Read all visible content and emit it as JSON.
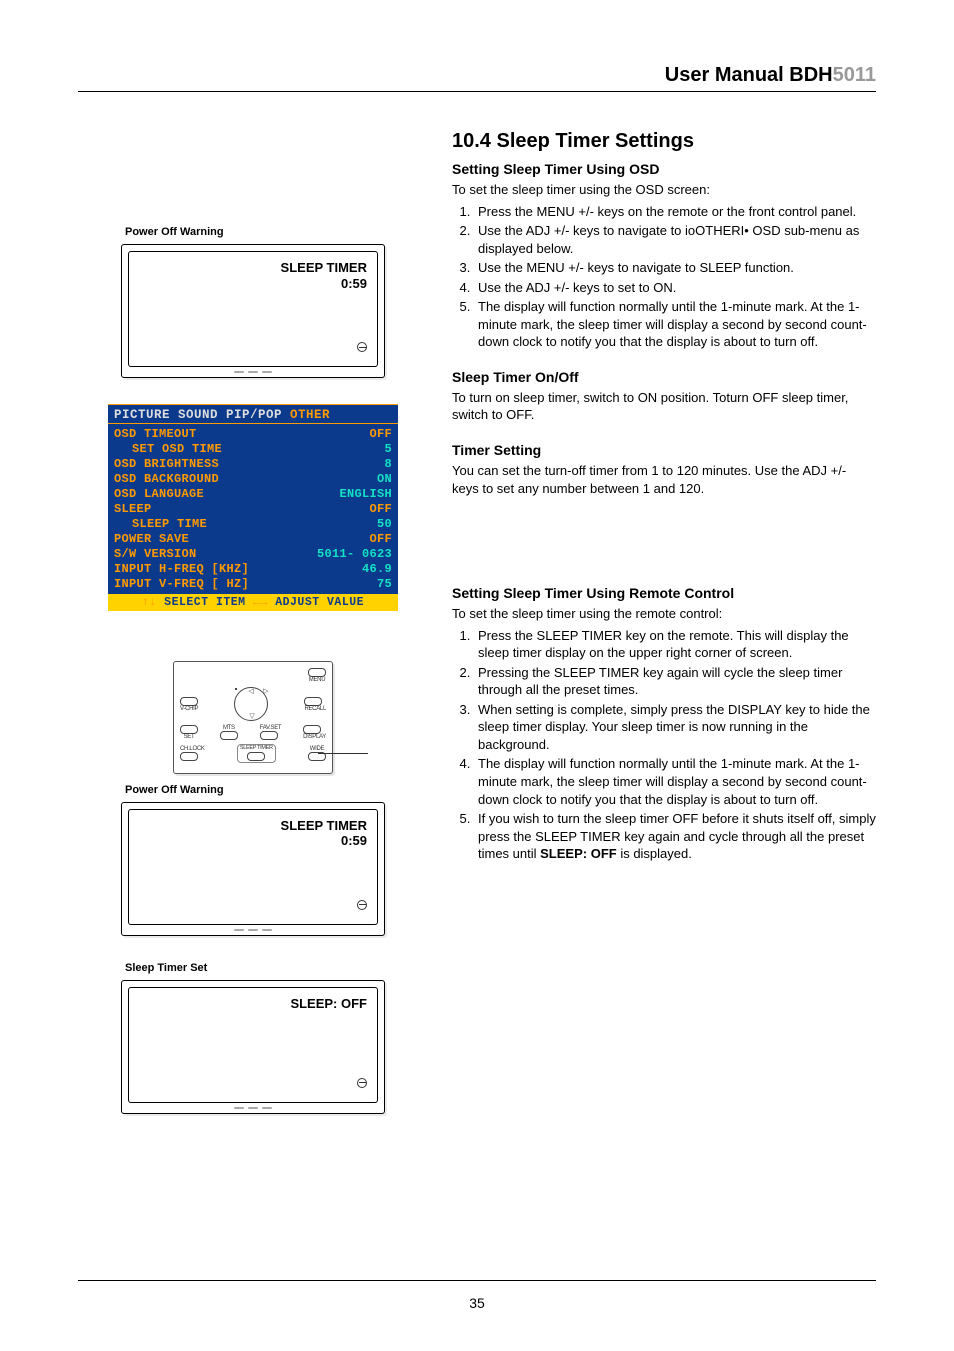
{
  "header": {
    "title": "User Manual BDH",
    "model": "5011"
  },
  "section": {
    "number_title": "10.4 Sleep Timer Settings",
    "osd_h": "Setting Sleep Timer Using OSD",
    "osd_intro": "To set the sleep timer using the OSD screen:",
    "osd_steps": [
      "Press the MENU +/- keys on the remote or the front control panel.",
      "Use the ADJ +/- keys to navigate to ioOTHERI• OSD sub-menu as displayed below.",
      "Use the MENU +/- keys to navigate to SLEEP function.",
      "Use the ADJ +/- keys to set to ON.",
      "The display will function normally until the 1-minute mark.  At the 1- minute mark, the sleep timer will display a second by second count- down clock to notify you that the display is about to turn off."
    ],
    "onoff_h": "Sleep Timer On/Off",
    "onoff_p": "To turn on sleep timer, switch to ON position. Toturn OFF sleep timer, switch to OFF.",
    "tset_h": "Timer Setting",
    "tset_p": "You can set the turn-off timer from 1 to 120 minutes. Use the ADJ +/- keys to set any number between 1 and 120.",
    "remote_h": "Setting Sleep Timer Using Remote Control",
    "remote_intro": "To set the sleep timer using the remote control:",
    "remote_steps": [
      "Press the SLEEP TIMER key on the remote.  This will display the sleep timer display on the upper right corner of screen.",
      "Pressing the SLEEP TIMER key again will cycle the sleep timer through all the preset times.",
      " When setting is complete, simply press the DISPLAY key to hide the sleep timer display.  Your sleep timer is now running in the background.",
      "The display will function normally until the 1-minute mark.  At the 1- minute mark, the sleep timer will display a second by second count-down clock to notify you that the display is about to turn off.",
      "If you wish to turn the sleep timer OFF before it shuts itself off, simply press the SLEEP TIMER key again and cycle through all the preset times until SLEEP: OFF is displayed."
    ]
  },
  "tv": {
    "caption_poweroff": "Power Off Warning",
    "caption_sleepset": "Sleep Timer Set",
    "sleep_timer_label": "SLEEP TIMER",
    "sleep_timer_value": "0:59",
    "sleep_off_label": "SLEEP: OFF"
  },
  "osd_menu": {
    "tabs": [
      "PICTURE",
      "SOUND",
      "PIP/POP",
      "OTHER"
    ],
    "active_tab_index": 3,
    "rows": [
      {
        "label": "OSD TIMEOUT",
        "value": "OFF",
        "vclass": "val-off",
        "indent": false
      },
      {
        "label": "SET OSD TIME",
        "value": "5",
        "vclass": "val-num",
        "indent": true
      },
      {
        "label": "OSD BRIGHTNESS",
        "value": "8",
        "vclass": "val-num",
        "indent": false
      },
      {
        "label": "OSD BACKGROUND",
        "value": "ON",
        "vclass": "val-on",
        "indent": false
      },
      {
        "label": "OSD LANGUAGE",
        "value": "ENGLISH",
        "vclass": "val-num",
        "indent": false
      },
      {
        "label": "SLEEP",
        "value": "OFF",
        "vclass": "val-off",
        "indent": false
      },
      {
        "label": "SLEEP TIME",
        "value": "50",
        "vclass": "val-num",
        "indent": true
      },
      {
        "label": "POWER SAVE",
        "value": "OFF",
        "vclass": "val-off",
        "indent": false
      },
      {
        "label": "S/W VERSION",
        "value": "5011- 0623",
        "vclass": "val-num",
        "indent": false
      },
      {
        "label": "INPUT H-FREQ [KHZ]",
        "value": "46.9",
        "vclass": "val-num",
        "indent": false
      },
      {
        "label": "INPUT V-FREQ [  HZ]",
        "value": "75",
        "vclass": "val-num",
        "indent": false
      }
    ],
    "footer_left": "SELECT ITEM",
    "footer_right": "ADJUST VALUE"
  },
  "remote_labels": {
    "vchip": "V-CHIP",
    "recall": "RECALL",
    "set": "SET",
    "mts": "MTS",
    "favset": "FAV.SET",
    "display": "DISPLAY",
    "chlock": "CH.LOCK",
    "sleep": "SLEEP TIMER",
    "wide": "WIDE",
    "menu": "MENU"
  },
  "page_number": "35"
}
